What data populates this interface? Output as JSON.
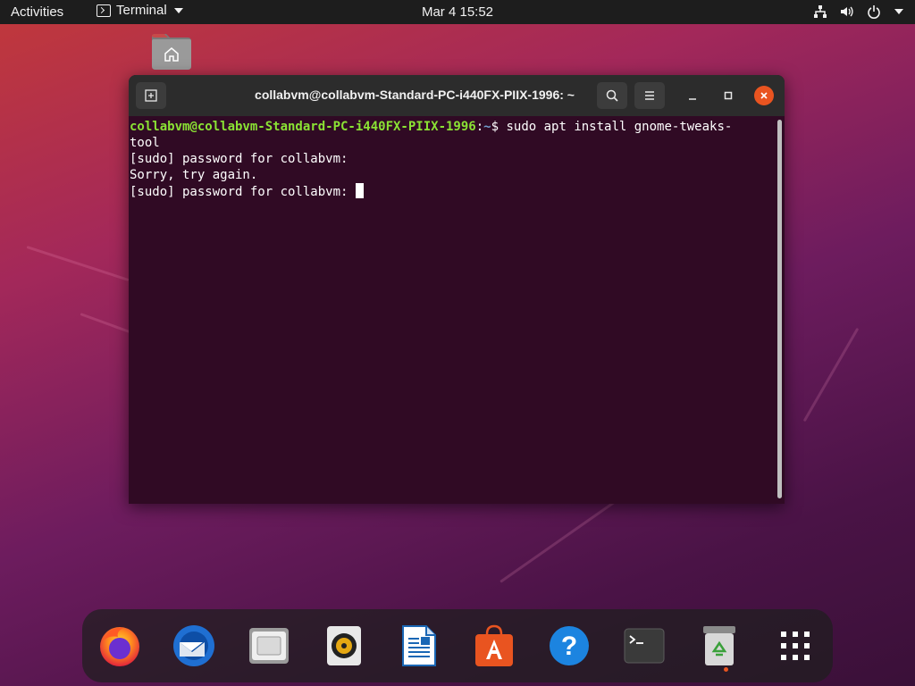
{
  "topbar": {
    "activities": "Activities",
    "app_name": "Terminal",
    "clock": "Mar 4  15:52",
    "tray_icons": [
      "network-icon",
      "volume-icon",
      "power-icon",
      "caret-down-icon"
    ]
  },
  "desktop": {
    "icons": [
      "home-folder-icon"
    ]
  },
  "terminal": {
    "title": "collabvm@collabvm-Standard-PC-i440FX-PIIX-1996: ~",
    "prompt_user": "collabvm@collabvm-Standard-PC-i440FX-PIIX-1996",
    "prompt_sep": ":",
    "prompt_path": "~",
    "prompt_symbol": "$ ",
    "command": "sudo apt install gnome-tweaks-",
    "command_wrap": "tool",
    "output": [
      "[sudo] password for collabvm:",
      "Sorry, try again.",
      "[sudo] password for collabvm: "
    ],
    "colors": {
      "background": "#300a24",
      "user": "#8ae234",
      "path": "#729fcf"
    }
  },
  "dock": {
    "items": [
      "firefox-icon",
      "thunderbird-icon",
      "files-icon",
      "rhythmbox-icon",
      "libreoffice-writer-icon",
      "ubuntu-software-icon",
      "help-icon",
      "terminal-icon",
      "trash-icon",
      "show-applications-icon"
    ],
    "running_indicator_color": "#e95420"
  }
}
